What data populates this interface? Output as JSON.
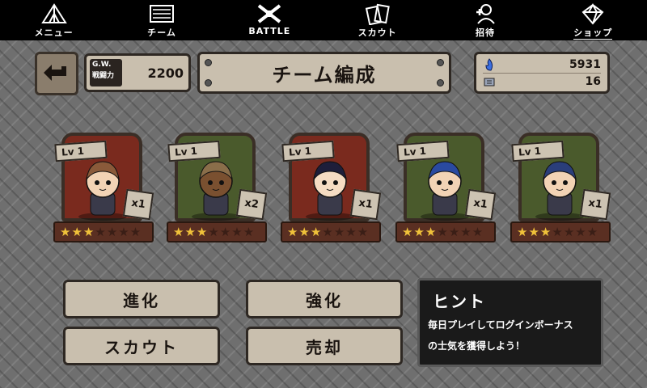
{
  "nav": [
    {
      "label": "メニュー",
      "icon": "tent-icon"
    },
    {
      "label": "チーム",
      "icon": "map-icon"
    },
    {
      "label": "BATTLE",
      "icon": "crossed-guns-icon"
    },
    {
      "label": "スカウト",
      "icon": "cards-icon"
    },
    {
      "label": "招待",
      "icon": "add-user-icon"
    },
    {
      "label": "ショップ",
      "icon": "gem-icon"
    }
  ],
  "gw": {
    "tag_line1": "G.W.",
    "tag_line2": "戦闘力",
    "value": "2200"
  },
  "title": "チーム編成",
  "currency": {
    "gems": "5931",
    "tickets": "16"
  },
  "cards": [
    {
      "level": "Lv 1",
      "count": "x1",
      "stars_filled": 3,
      "stars_total": 7,
      "frame": "#7a2a1e",
      "skin": "#f2d3b5",
      "hair": "#8a5a3a"
    },
    {
      "level": "Lv 1",
      "count": "x2",
      "stars_filled": 3,
      "stars_total": 7,
      "frame": "#4a5a2c",
      "skin": "#7a5030",
      "hair": "#8a6e4a"
    },
    {
      "level": "Lv 1",
      "count": "x1",
      "stars_filled": 3,
      "stars_total": 7,
      "frame": "#7a2a1e",
      "skin": "#f5dcc3",
      "hair": "#1e1e3a"
    },
    {
      "level": "Lv 1",
      "count": "x1",
      "stars_filled": 3,
      "stars_total": 7,
      "frame": "#4a5a2c",
      "skin": "#f2d3b5",
      "hair": "#2a4aa0"
    },
    {
      "level": "Lv 1",
      "count": "x1",
      "stars_filled": 3,
      "stars_total": 7,
      "frame": "#4a5a2c",
      "skin": "#f2d3b5",
      "hair": "#2a3e7a"
    }
  ],
  "buttons": {
    "evolve": "進化",
    "enhance": "強化",
    "scout": "スカウト",
    "sell": "売却"
  },
  "hint": {
    "title": "ヒント",
    "line1": "毎日プレイしてログインボーナス",
    "line2": "の士気を獲得しよう！"
  }
}
